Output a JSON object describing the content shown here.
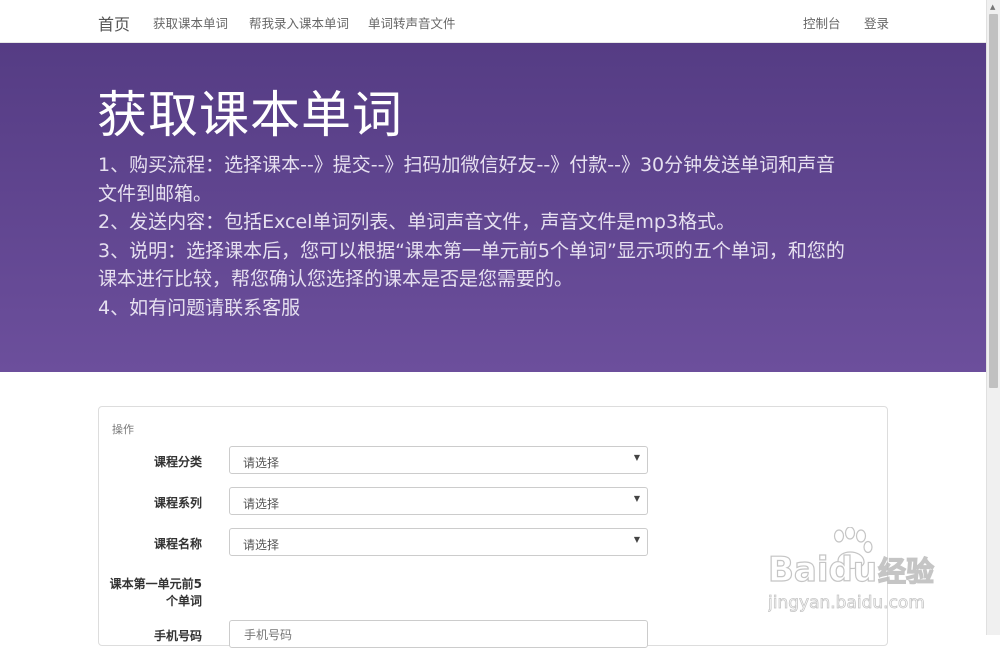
{
  "nav": {
    "brand": "首页",
    "links": [
      "获取课本单词",
      "帮我录入课本单词",
      "单词转声音文件"
    ],
    "right": [
      "控制台",
      "登录"
    ]
  },
  "hero": {
    "title": "获取课本单词",
    "lines": [
      "1、购买流程：选择课本--》提交--》扫码加微信好友--》付款--》30分钟发送单词和声音",
      "文件到邮箱。",
      "2、发送内容：包括Excel单词列表、单词声音文件，声音文件是mp3格式。",
      "3、说明：选择课本后，您可以根据“课本第一单元前5个单词”显示项的五个单词，和您的",
      "课本进行比较，帮您确认您选择的课本是否是您需要的。",
      "4、如有问题请联系客服"
    ]
  },
  "panel": {
    "title": "操作",
    "fields": [
      {
        "label": "课程分类",
        "value": "请选择"
      },
      {
        "label": "课程系列",
        "value": "请选择"
      },
      {
        "label": "课程名称",
        "value": "请选择"
      }
    ],
    "preview_label_line1": "课本第一单元前5",
    "preview_label_line2": "个单词",
    "phone_label": "手机号码",
    "phone_placeholder": "手机号码"
  },
  "watermark": {
    "brand": "Baidu",
    "cn": "经验",
    "url": "jingyan.baidu.com"
  },
  "colors": {
    "hero_top": "#553c84",
    "hero_bottom": "#6c4f9c"
  }
}
